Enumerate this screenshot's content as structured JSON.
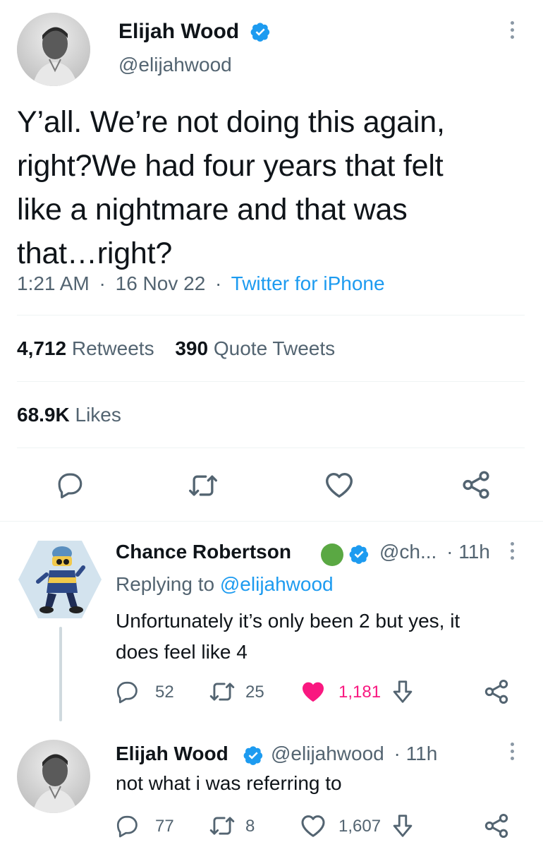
{
  "main_tweet": {
    "author_name": "Elijah Wood",
    "author_handle": "@elijahwood",
    "text_lines": [
      "Y’all. We’re not doing this again,",
      "right?We had four years that felt",
      "like a nightmare and that was",
      "that…right?"
    ],
    "time": "1:21 AM",
    "date": "16 Nov 22",
    "separator": "·",
    "source": "Twitter for iPhone",
    "retweets_count": "4,712",
    "retweets_label": "Retweets",
    "quotes_count": "390",
    "quotes_label": "Quote Tweets",
    "likes_count": "68.9K",
    "likes_label": "Likes"
  },
  "replies": [
    {
      "author_name": "Chance Robertson",
      "author_handle": "@ch...",
      "time": "· 11h",
      "replying_prefix": "Replying to ",
      "replying_to": "@elijahwood",
      "text_lines": [
        "Unfortunately it’s only been 2 but yes, it",
        "does feel like 4"
      ],
      "replies": "52",
      "retweets": "25",
      "likes": "1,181",
      "liked": true
    },
    {
      "author_name": "Elijah Wood",
      "author_handle": "@elijahwood",
      "time": "· 11h",
      "text_lines": [
        "not what i was referring to"
      ],
      "replies": "77",
      "retweets": "8",
      "likes": "1,607",
      "liked": false
    }
  ],
  "colors": {
    "accent": "#1d9bf0",
    "like_pink": "#f91880",
    "muted": "#536471",
    "status_green": "#5aa843"
  }
}
